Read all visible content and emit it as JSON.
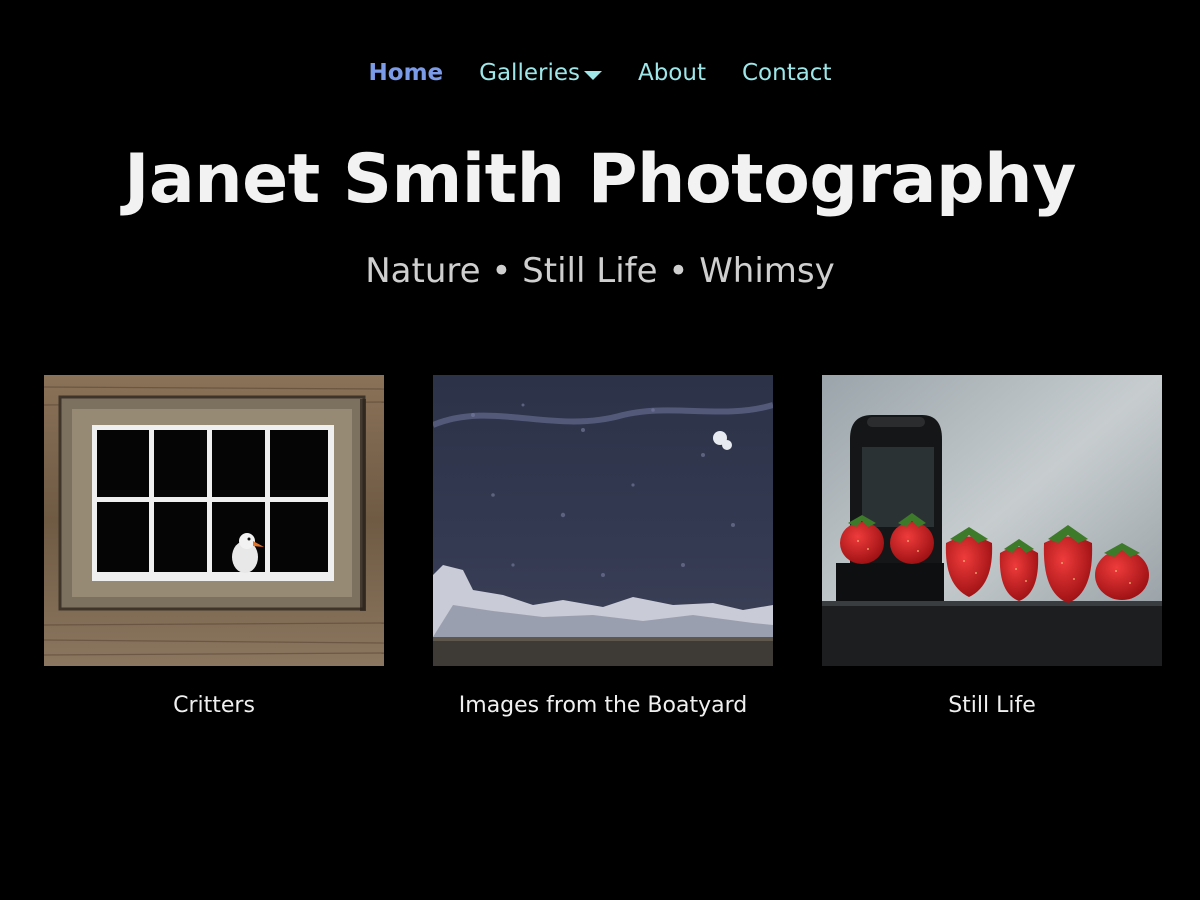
{
  "nav": {
    "items": [
      {
        "label": "Home",
        "active": true
      },
      {
        "label": "Galleries",
        "dropdown": true
      },
      {
        "label": "About"
      },
      {
        "label": "Contact"
      }
    ]
  },
  "header": {
    "title": "Janet Smith Photography",
    "subtitle": "Nature • Still Life • Whimsy"
  },
  "gallery": {
    "cards": [
      {
        "label": "Critters",
        "image": "goose-in-barn-window"
      },
      {
        "label": "Images from the Boatyard",
        "image": "boat-hull-texture"
      },
      {
        "label": "Still Life",
        "image": "strawberries-on-shelf"
      }
    ]
  },
  "colors": {
    "background": "#000000",
    "nav_link": "#9ee6e8",
    "nav_active": "#7b9be8",
    "title": "#f2f2f2",
    "subtitle": "#cfcfcf"
  }
}
